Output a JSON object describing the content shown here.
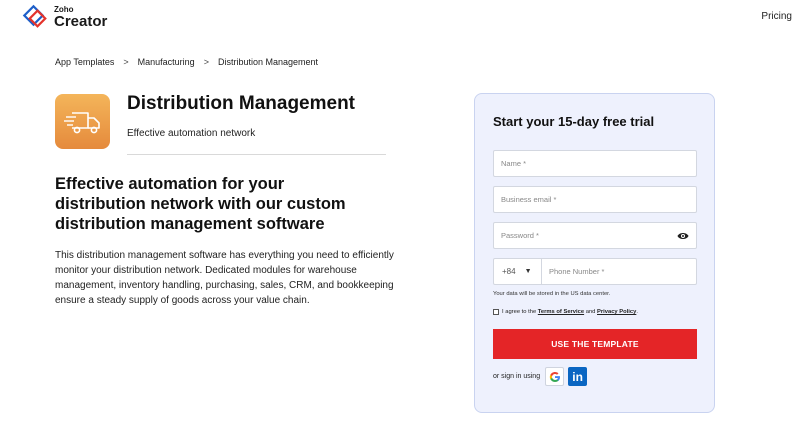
{
  "header": {
    "brand_small": "Zoho",
    "brand_big": "Creator",
    "pricing_label": "Pricing"
  },
  "breadcrumb": {
    "items": [
      "App Templates",
      "Manufacturing",
      "Distribution Management"
    ],
    "separator": ">"
  },
  "product": {
    "icon": "truck-icon",
    "title": "Distribution Management",
    "subtitle": "Effective automation network",
    "headline": "Effective automation for your distribution network with our custom distribution management software",
    "description": "This distribution management software has everything you need to efficiently monitor your distribution network. Dedicated modules for warehouse management, inventory handling, purchasing, sales, CRM, and bookkeeping ensure a steady supply of goods across your value chain."
  },
  "signup": {
    "title": "Start your 15-day free trial",
    "name_placeholder": "Name *",
    "email_placeholder": "Business email *",
    "password_placeholder": "Password *",
    "country_code": "+84",
    "phone_placeholder": "Phone Number *",
    "data_note": "Your data will be stored in the US data center.",
    "agree_prefix": "I agree to the ",
    "terms_label": "Terms of Service",
    "agree_and": " and ",
    "privacy_label": "Privacy Policy",
    "agree_suffix": ".",
    "submit_label": "USE THE TEMPLATE",
    "signin_label": "or sign in using",
    "linkedin_label": "in"
  },
  "colors": {
    "accent": "#e42527",
    "card_bg": "#eef1fd",
    "icon_gradient_top": "#f4b55a",
    "icon_gradient_bottom": "#e58a3c"
  }
}
